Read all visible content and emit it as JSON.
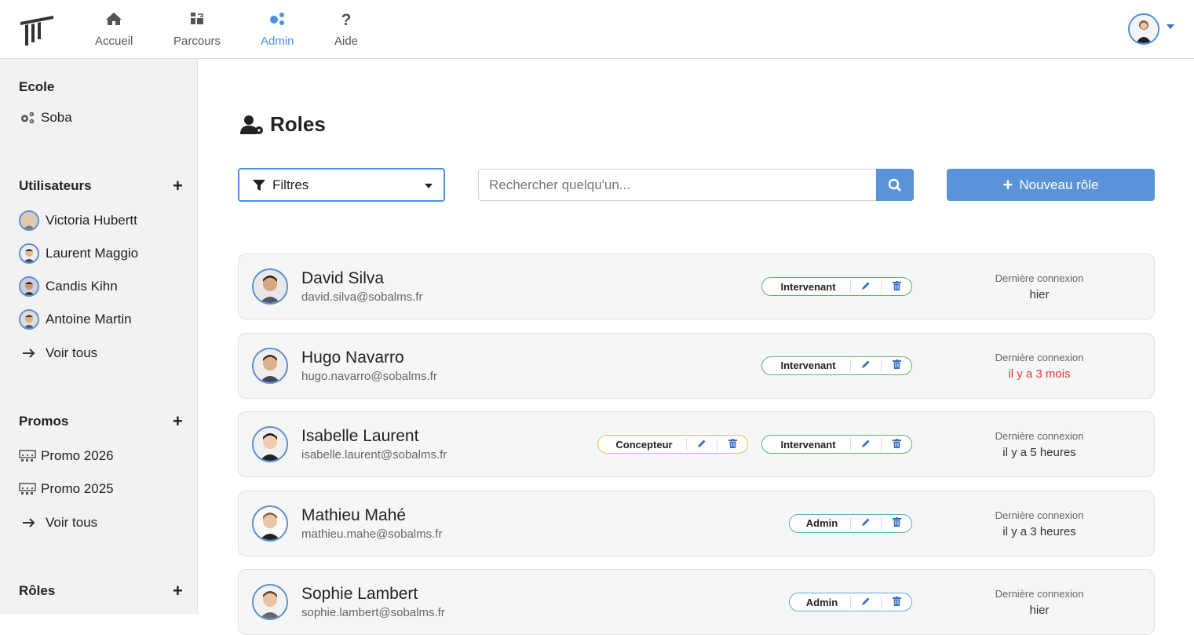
{
  "nav": {
    "items": [
      {
        "label": "Accueil",
        "icon": "home-icon"
      },
      {
        "label": "Parcours",
        "icon": "path-icon"
      },
      {
        "label": "Admin",
        "icon": "cogs-icon",
        "active": true
      },
      {
        "label": "Aide",
        "icon": "question-icon"
      }
    ]
  },
  "sidebar": {
    "ecole_heading": "Ecole",
    "ecole_item": "Soba",
    "users_heading": "Utilisateurs",
    "users": [
      "Victoria Hubertt",
      "Laurent Maggio",
      "Candis Kihn",
      "Antoine Martin"
    ],
    "users_see_all": "Voir tous",
    "promos_heading": "Promos",
    "promos": [
      "Promo 2026",
      "Promo 2025"
    ],
    "promos_see_all": "Voir tous",
    "roles_heading": "Rôles"
  },
  "main": {
    "title": "Roles",
    "filter_label": "Filtres",
    "search_placeholder": "Rechercher quelqu'un...",
    "new_role_label": "Nouveau rôle",
    "last_login_label": "Dernière connexion"
  },
  "people": [
    {
      "name": "David Silva",
      "email": "david.silva@sobalms.fr",
      "roles": [
        {
          "label": "Intervenant",
          "color": "green"
        }
      ],
      "last": "hier",
      "last_red": false
    },
    {
      "name": "Hugo Navarro",
      "email": "hugo.navarro@sobalms.fr",
      "roles": [
        {
          "label": "Intervenant",
          "color": "green"
        }
      ],
      "last": "il y a 3 mois",
      "last_red": true
    },
    {
      "name": "Isabelle Laurent",
      "email": "isabelle.laurent@sobalms.fr",
      "roles": [
        {
          "label": "Concepteur",
          "color": "yellow"
        },
        {
          "label": "Intervenant",
          "color": "green"
        }
      ],
      "last": "il y a 5 heures",
      "last_red": false
    },
    {
      "name": "Mathieu Mahé",
      "email": "mathieu.mahe@sobalms.fr",
      "roles": [
        {
          "label": "Admin",
          "color": "teal"
        }
      ],
      "last": "il y a 3 heures",
      "last_red": false
    },
    {
      "name": "Sophie Lambert",
      "email": "sophie.lambert@sobalms.fr",
      "roles": [
        {
          "label": "Admin",
          "color": "teal"
        }
      ],
      "last": "hier",
      "last_red": false
    }
  ],
  "colors": {
    "accent": "#5b93d9",
    "active_nav": "#4a90e2",
    "red": "#e53935"
  }
}
